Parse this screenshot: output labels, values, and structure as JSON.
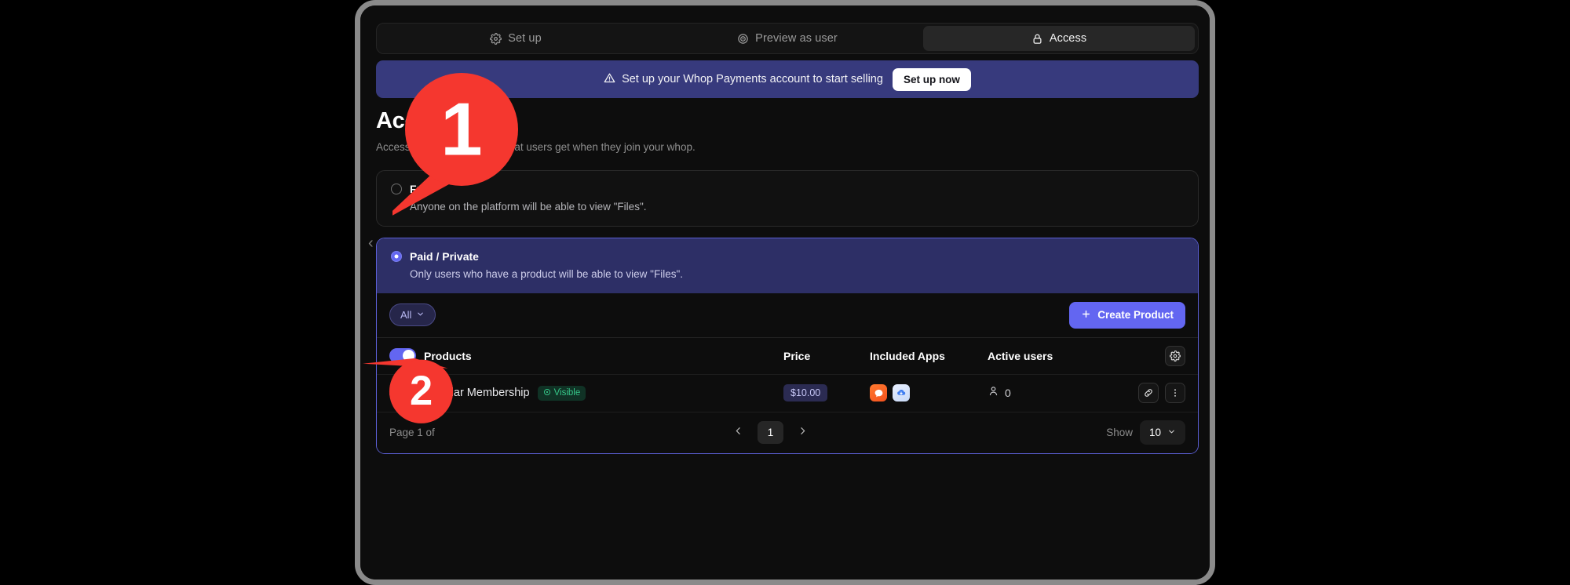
{
  "tabs": [
    {
      "id": "setup",
      "label": "Set up",
      "icon": "gear-icon",
      "active": false
    },
    {
      "id": "preview",
      "label": "Preview as user",
      "icon": "eye-icon",
      "active": false
    },
    {
      "id": "access",
      "label": "Access",
      "icon": "lock-icon",
      "active": true
    }
  ],
  "banner": {
    "icon": "warning-icon",
    "message": "Set up your Whop Payments account to start selling",
    "button_label": "Set up now",
    "bg_color": "#373a7d"
  },
  "page": {
    "title": "Access",
    "subtitle": "Access is how you control what users get when they join your whop."
  },
  "options": [
    {
      "id": "free",
      "title": "Free",
      "description": "Anyone on the platform will be able to view \"Files\".",
      "selected": false
    },
    {
      "id": "paid-private",
      "title": "Paid / Private",
      "description": "Only users who have a product will be able to view \"Files\".",
      "selected": true
    }
  ],
  "products_panel": {
    "filter": {
      "label": "All",
      "icon": "chevron-down-icon"
    },
    "create_button": {
      "label": "Create Product",
      "icon": "plus-icon",
      "color": "#6366f1"
    },
    "table": {
      "columns": [
        "Products",
        "Price",
        "Included Apps",
        "Active users"
      ],
      "settings_icon": "gear-icon",
      "header_toggle_on": true,
      "rows": [
        {
          "toggle_on": true,
          "name": "Regular Membership",
          "visibility_badge": "Visible",
          "visibility_color": "#36c98a",
          "price": "$10.00",
          "apps": [
            "chat-app-icon",
            "files-app-icon"
          ],
          "active_users": "0",
          "actions": [
            "link-icon",
            "more-options-icon"
          ]
        }
      ]
    },
    "pagination": {
      "page_label": "Page 1 of",
      "prev_icon": "chevron-left-icon",
      "next_icon": "chevron-right-icon",
      "current_page": "1",
      "show_label": "Show",
      "show_value": "10",
      "show_icon": "chevron-down-icon"
    }
  },
  "collapse_handle": {
    "icon": "chevron-left-icon",
    "glyph": "‹"
  },
  "markers": [
    {
      "id": "1",
      "number": "1",
      "color": "#f5372f"
    },
    {
      "id": "2",
      "number": "2",
      "color": "#f5372f"
    }
  ]
}
